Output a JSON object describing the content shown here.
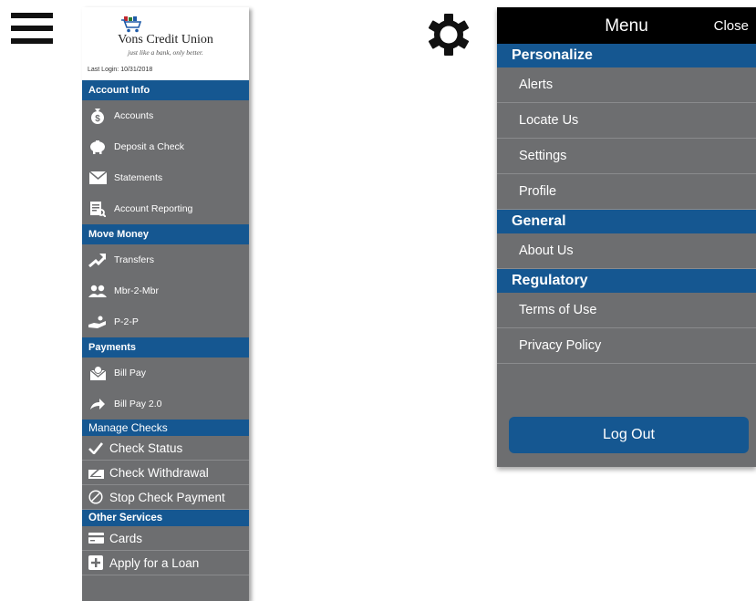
{
  "left_menu": {
    "bank_name": "Vons Credit Union",
    "tagline": "just like a bank, only better.",
    "last_login": "Last Login: 10/31/2018",
    "sections": {
      "account_info": {
        "title": "Account Info",
        "items": [
          "Accounts",
          "Deposit a Check",
          "Statements",
          "Account Reporting"
        ]
      },
      "move_money": {
        "title": "Move Money",
        "items": [
          "Transfers",
          "Mbr-2-Mbr",
          "P-2-P"
        ]
      },
      "payments": {
        "title": "Payments",
        "items": [
          "Bill Pay",
          "Bill Pay 2.0"
        ]
      },
      "manage_checks": {
        "title": "Manage Checks",
        "items": [
          "Check Status",
          "Check Withdrawal",
          "Stop Check Payment"
        ]
      },
      "other_services": {
        "title": "Other Services",
        "items": [
          "Cards",
          "Apply for a Loan"
        ]
      }
    }
  },
  "right_menu": {
    "title": "Menu",
    "close_label": "Close",
    "sections": {
      "personalize": {
        "title": "Personalize",
        "items": [
          "Alerts",
          "Locate Us",
          "Settings",
          "Profile"
        ]
      },
      "general": {
        "title": "General",
        "items": [
          "About Us"
        ]
      },
      "regulatory": {
        "title": "Regulatory",
        "items": [
          "Terms of Use",
          "Privacy Policy"
        ]
      }
    },
    "logout_label": "Log Out"
  },
  "icons": {
    "menu": "hamburger-icon",
    "settings": "gear-icon"
  },
  "colors": {
    "header_blue": "#155791",
    "panel_gray": "#6d6e70",
    "menu_bar": "#000000"
  }
}
